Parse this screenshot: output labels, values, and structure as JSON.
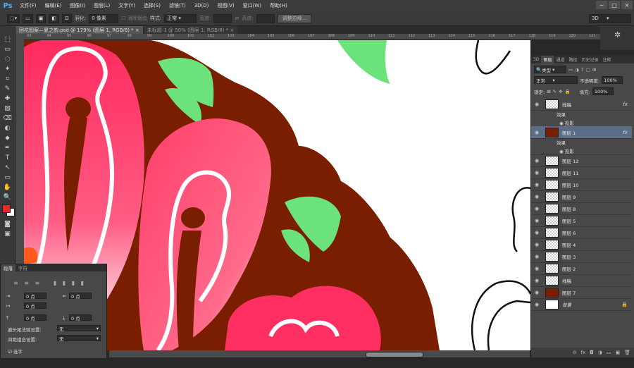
{
  "app": {
    "logo": "Ps"
  },
  "menu": [
    "文件(F)",
    "编辑(E)",
    "图像(I)",
    "图层(L)",
    "文字(Y)",
    "选择(S)",
    "滤镜(T)",
    "3D(D)",
    "视图(V)",
    "窗口(W)",
    "帮助(H)"
  ],
  "window_buttons": [
    "−",
    "□",
    "×"
  ],
  "options": {
    "feather_label": "羽化:",
    "feather_value": "0 像素",
    "antialias_label": "消除锯齿",
    "style_label": "样式:",
    "style_value": "正常",
    "width_label": "宽度:",
    "height_label": "高度:",
    "refine_button": "调整边缘...",
    "workspace": "3D"
  },
  "tabs": [
    {
      "label": "团花图案—夏之韵.psd @ 179% (图层 1, RGB/8) *",
      "close": "×"
    },
    {
      "label": "未标题-1 @ 50% (图层 1, RGB/8) *",
      "close": "×"
    }
  ],
  "ruler_ticks": [
    "93",
    "94",
    "95",
    "96",
    "97",
    "98",
    "99",
    "100",
    "101",
    "102",
    "103",
    "104",
    "105",
    "106",
    "107",
    "108",
    "109",
    "110",
    "111",
    "112",
    "113",
    "114",
    "115",
    "116",
    "117",
    "118",
    "119",
    "120",
    "121"
  ],
  "tools": [
    "⬚",
    "▭",
    "◌",
    "✦",
    "⌗",
    "✎",
    "✚",
    "▧",
    "⌫",
    "◐",
    "⬥",
    "✒",
    "T",
    "↖",
    "▭",
    "✋",
    "🔍"
  ],
  "layers_panel": {
    "tabs": [
      "3D",
      "图层",
      "通道",
      "路径",
      "历史记录",
      "注释"
    ],
    "kind_label": "类型",
    "blend_mode": "正常",
    "opacity_label": "不透明度:",
    "opacity_value": "100%",
    "lock_label": "锁定:",
    "fill_label": "填充:",
    "fill_value": "100%",
    "layers": [
      {
        "name": "线稿",
        "fx": "fx",
        "effects_label": "效果",
        "effect": "投影"
      },
      {
        "name": "图层 1",
        "fx": "fx",
        "effects_label": "效果",
        "effect": "投影",
        "selected": true
      },
      {
        "name": "图层 12"
      },
      {
        "name": "图层 11"
      },
      {
        "name": "图层 10"
      },
      {
        "name": "图层 9"
      },
      {
        "name": "图层 8"
      },
      {
        "name": "图层 5"
      },
      {
        "name": "图层 6"
      },
      {
        "name": "图层 4"
      },
      {
        "name": "图层 3"
      },
      {
        "name": "图层 2"
      },
      {
        "name": "线稿"
      },
      {
        "name": "图层 7"
      },
      {
        "name": "背景",
        "locked": true
      }
    ],
    "footer_icons": [
      "⊝",
      "fx",
      "◘",
      "◑",
      "▭",
      "▣",
      "🗑"
    ]
  },
  "paragraph_panel": {
    "tabs": [
      "段落",
      "字符"
    ],
    "fields": [
      "0 点",
      "0 点",
      "0 点",
      "0 点",
      "0 点"
    ],
    "kinsoku_label": "避头尾法则设置:",
    "kinsoku_value": "无",
    "mojikumi_label": "间距组合设置:",
    "mojikumi_value": "无",
    "hyphenate_label": "连字"
  },
  "colors": {
    "fg": "#e8262c",
    "bg": "#ffffff",
    "pink": "#ff3a6a",
    "dark": "#7a1a00",
    "green": "#6be27a"
  }
}
